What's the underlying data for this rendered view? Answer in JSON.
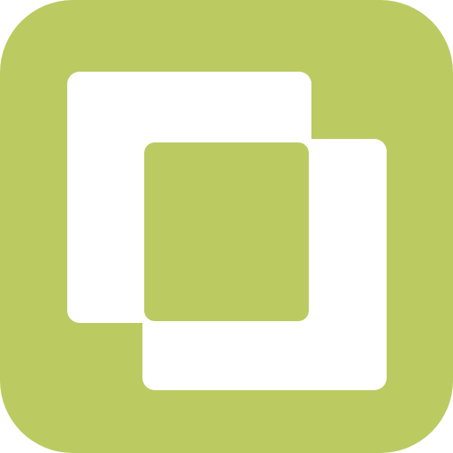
{
  "app_icon": {
    "icon_name": "overlapping-squares-icon",
    "background_color": "#BBCB62",
    "foreground_color": "#FFFFFF"
  }
}
